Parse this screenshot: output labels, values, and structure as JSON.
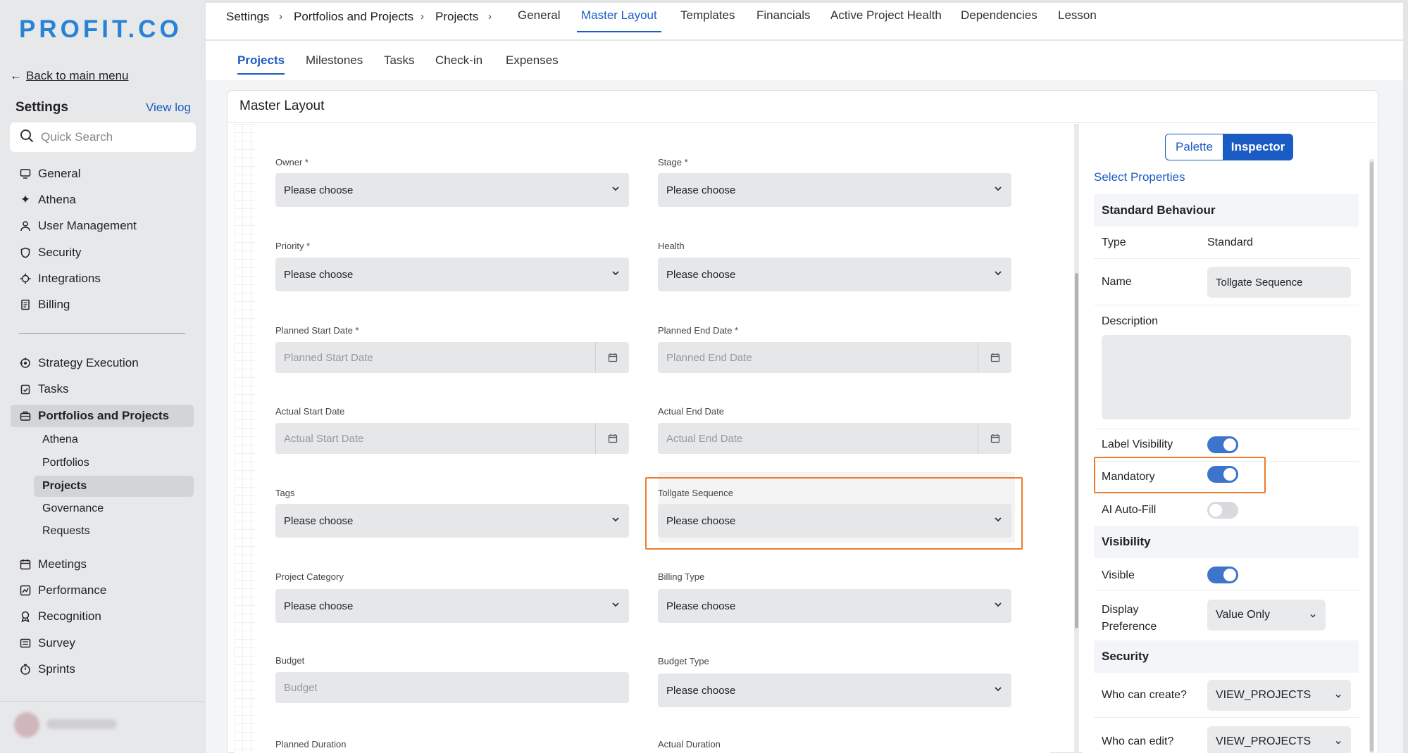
{
  "brand": {
    "logo": "PROFIT.CO"
  },
  "sidebar": {
    "back_label": "Back to main menu",
    "title": "Settings",
    "view_log": "View log",
    "search_placeholder": "Quick Search",
    "items": [
      {
        "label": "General",
        "icon": "monitor-icon"
      },
      {
        "label": "Athena",
        "icon": "sparkle-icon"
      },
      {
        "label": "User Management",
        "icon": "user-icon"
      },
      {
        "label": "Security",
        "icon": "shield-icon"
      },
      {
        "label": "Integrations",
        "icon": "plug-icon"
      },
      {
        "label": "Billing",
        "icon": "receipt-icon"
      }
    ],
    "items2": [
      {
        "label": "Strategy Execution",
        "icon": "target-icon"
      },
      {
        "label": "Tasks",
        "icon": "clipboard-icon"
      },
      {
        "label": "Portfolios and Projects",
        "icon": "briefcase-icon"
      }
    ],
    "subitems": [
      "Athena",
      "Portfolios",
      "Projects",
      "Governance",
      "Requests"
    ],
    "items3": [
      {
        "label": "Meetings",
        "icon": "calendar-icon"
      },
      {
        "label": "Performance",
        "icon": "chart-icon"
      },
      {
        "label": "Recognition",
        "icon": "award-icon"
      },
      {
        "label": "Survey",
        "icon": "survey-icon"
      },
      {
        "label": "Sprints",
        "icon": "timer-icon"
      }
    ]
  },
  "breadcrumb": [
    "Settings",
    "Portfolios and Projects",
    "Projects"
  ],
  "tabs": [
    "General",
    "Master Layout",
    "Templates",
    "Financials",
    "Active Project Health",
    "Dependencies",
    "Lesson"
  ],
  "subtabs": [
    "Projects",
    "Milestones",
    "Tasks",
    "Check-in",
    "Expenses"
  ],
  "card": {
    "title": "Master Layout"
  },
  "form": {
    "owner_label": "Owner *",
    "stage_label": "Stage *",
    "priority_label": "Priority *",
    "health_label": "Health",
    "pstart_label": "Planned Start Date *",
    "pstart_ph": "Planned Start Date",
    "pend_label": "Planned End Date *",
    "pend_ph": "Planned End Date",
    "astart_label": "Actual Start Date",
    "astart_ph": "Actual Start Date",
    "aend_label": "Actual End Date",
    "aend_ph": "Actual End Date",
    "tags_label": "Tags",
    "tollgate_label": "Tollgate Sequence",
    "category_label": "Project Category",
    "billing_label": "Billing Type",
    "budget_label": "Budget",
    "budget_ph": "Budget",
    "budget_type_label": "Budget Type",
    "pduration_label": "Planned Duration",
    "aduration_label": "Actual Duration",
    "choose": "Please choose"
  },
  "inspector": {
    "palette_btn": "Palette",
    "inspector_btn": "Inspector",
    "select_props": "Select Properties",
    "std_behaviour": "Standard Behaviour",
    "type_key": "Type",
    "type_val": "Standard",
    "name_key": "Name",
    "name_val": "Tollgate Sequence",
    "desc_key": "Description",
    "label_vis_key": "Label Visibility",
    "label_vis_on": true,
    "mandatory_key": "Mandatory",
    "mandatory_on": true,
    "ai_key": "AI Auto-Fill",
    "ai_on": false,
    "visibility_section": "Visibility",
    "visible_key": "Visible",
    "visible_on": true,
    "display_key_1": "Display",
    "display_key_2": "Preference",
    "display_val": "Value Only",
    "security_section": "Security",
    "create_key": "Who can create?",
    "create_val": "VIEW_PROJECTS",
    "edit_key": "Who can edit?",
    "edit_val": "VIEW_PROJECTS"
  },
  "colors": {
    "accent": "#1a5bc4",
    "brand": "#2a82d7",
    "highlight": "#f07a2e",
    "toggle_on": "#3d74cc"
  }
}
